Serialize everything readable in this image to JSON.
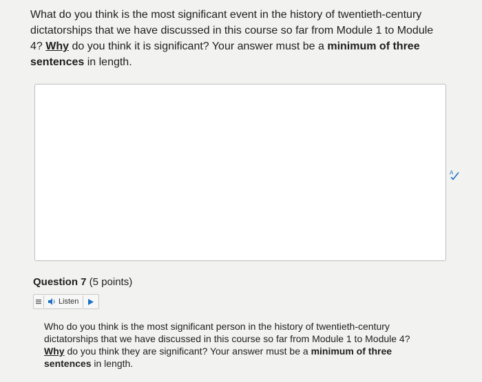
{
  "question6": {
    "text_part1": "What do you think is the most significant event in the history of twentieth-century dictatorships that we have discussed in this course so far from Module 1 to Module 4? ",
    "why": "Why",
    "text_part2": " do you think it is significant? Your answer must be a ",
    "min_phrase": "minimum of three sentences",
    "text_part3": " in length."
  },
  "answer_box": {
    "value": ""
  },
  "question7": {
    "title": "Question 7",
    "points": " (5 points)",
    "listen_label": "Listen",
    "text_part1": "Who do you think is the most significant person in the history of twentieth-century dictatorships that we have discussed in this course so far from Module 1 to Module 4? ",
    "why": "Why",
    "text_part2": " do you think they are significant? Your answer must be a ",
    "min_phrase": "minimum of three sentences",
    "text_part3": " in length."
  },
  "icons": {
    "spellcheck": "spellcheck-icon",
    "menu": "menu-icon",
    "speaker": "speaker-icon",
    "play": "play-icon"
  },
  "colors": {
    "accent": "#1a6fc4",
    "text": "#1e1e1e"
  }
}
